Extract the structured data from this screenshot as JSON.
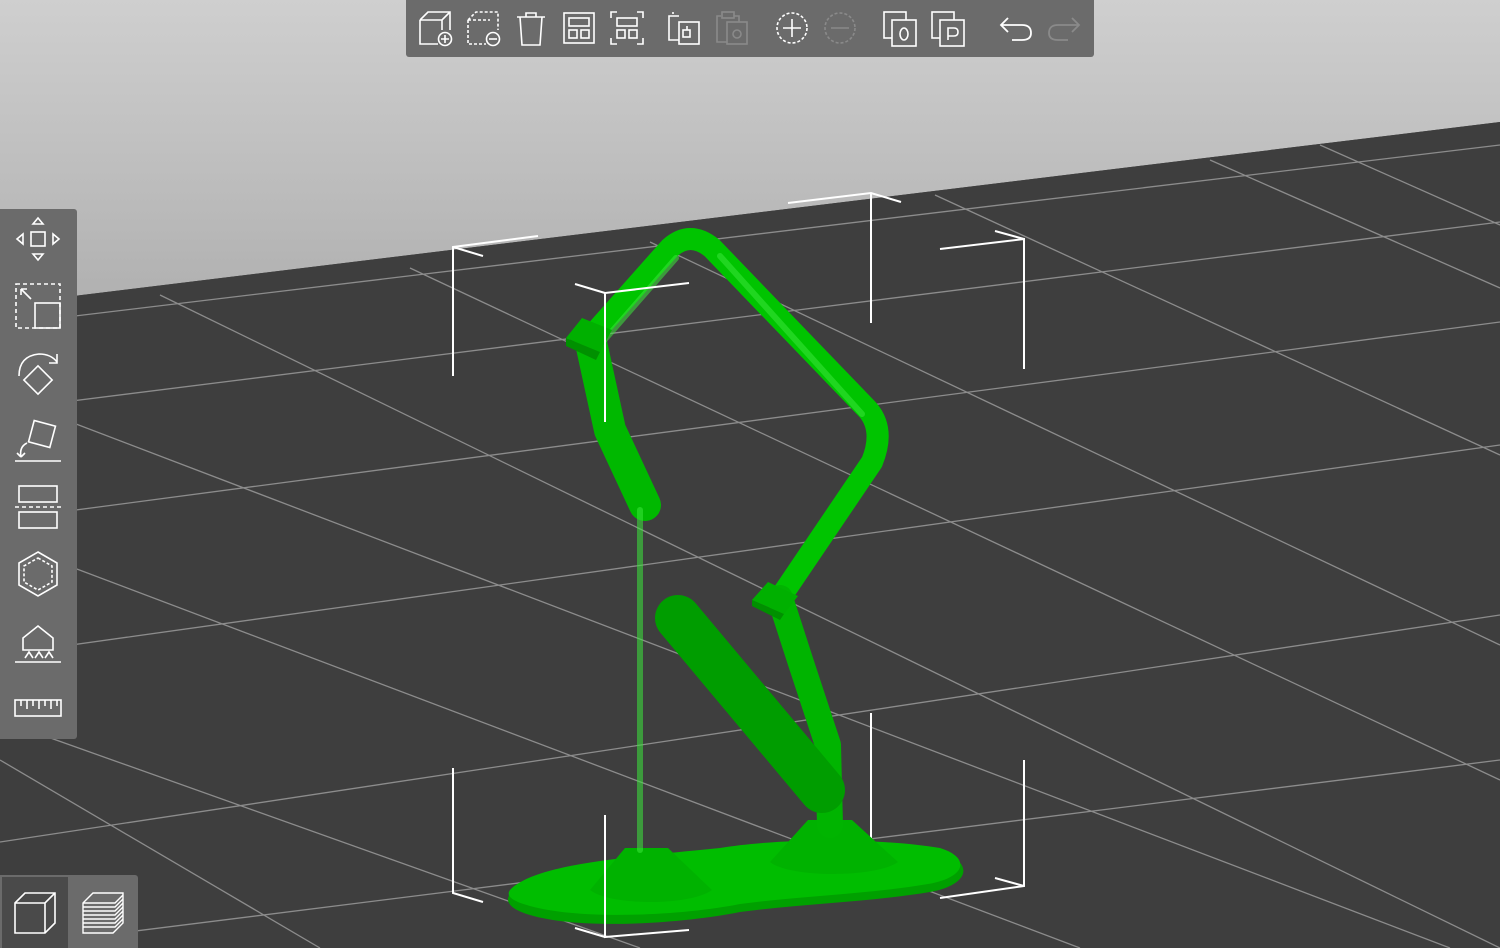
{
  "app": {
    "view": "3D editor"
  },
  "colors": {
    "model": "#00c800",
    "model_dark": "#008c00",
    "bed": "#3e3e3e",
    "background_top": "#b3b3b3",
    "toolbar": "#6b6b6b",
    "icon_stroke": "#ffffff",
    "icon_disabled": "#8a8a8a"
  },
  "top_toolbar": {
    "buttons": [
      {
        "name": "add",
        "icon": "add-object-icon",
        "enabled": true
      },
      {
        "name": "delete",
        "icon": "delete-object-icon",
        "enabled": true
      },
      {
        "name": "delete-all",
        "icon": "trash-icon",
        "enabled": true
      },
      {
        "name": "arrange",
        "icon": "arrange-icon",
        "enabled": true
      },
      {
        "name": "arrange-selection",
        "icon": "arrange-selection-icon",
        "enabled": true
      },
      {
        "name": "copy",
        "icon": "copy-icon",
        "enabled": true
      },
      {
        "name": "paste",
        "icon": "paste-icon",
        "enabled": false
      },
      {
        "name": "add-instance",
        "icon": "plus-circle-icon",
        "enabled": true
      },
      {
        "name": "remove-instance",
        "icon": "minus-circle-icon",
        "enabled": false
      },
      {
        "name": "split-objects",
        "icon": "split-objects-icon",
        "enabled": true
      },
      {
        "name": "split-parts",
        "icon": "split-parts-icon",
        "enabled": true
      },
      {
        "name": "undo",
        "icon": "undo-icon",
        "enabled": true
      },
      {
        "name": "redo",
        "icon": "redo-icon",
        "enabled": false
      }
    ]
  },
  "left_toolbar": {
    "tools": [
      {
        "name": "move",
        "icon": "move-icon"
      },
      {
        "name": "scale",
        "icon": "scale-icon"
      },
      {
        "name": "rotate",
        "icon": "rotate-icon"
      },
      {
        "name": "place-on-face",
        "icon": "place-on-face-icon"
      },
      {
        "name": "cut",
        "icon": "cut-icon"
      },
      {
        "name": "hollow",
        "icon": "hollow-icon"
      },
      {
        "name": "supports",
        "icon": "supports-icon"
      },
      {
        "name": "measure",
        "icon": "ruler-icon"
      }
    ]
  },
  "view_toggle": {
    "active": "3d",
    "buttons": [
      {
        "name": "3d-view",
        "icon": "cube-icon"
      },
      {
        "name": "preview",
        "icon": "layers-icon"
      }
    ]
  }
}
